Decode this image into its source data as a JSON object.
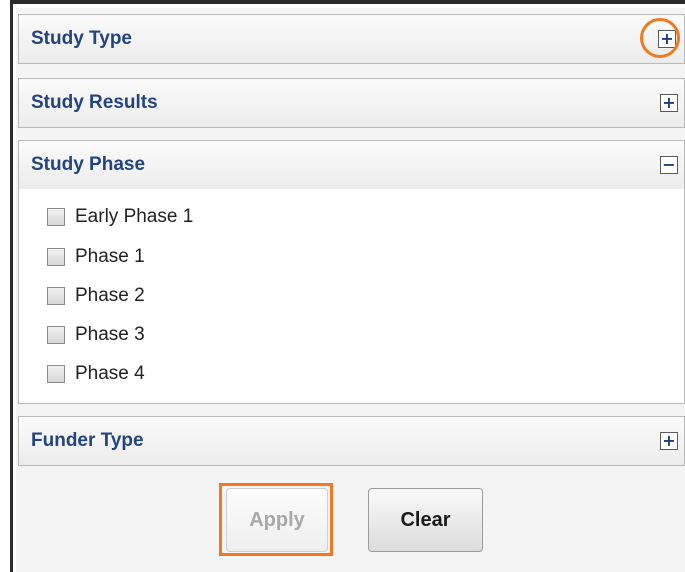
{
  "sections": {
    "study_type": {
      "title": "Study Type",
      "toggle": "+"
    },
    "study_results": {
      "title": "Study Results",
      "toggle": "+"
    },
    "study_phase": {
      "title": "Study Phase",
      "toggle": "−",
      "options": [
        "Early Phase 1",
        "Phase 1",
        "Phase 2",
        "Phase 3",
        "Phase 4"
      ]
    },
    "funder_type": {
      "title": "Funder Type",
      "toggle": "+"
    }
  },
  "buttons": {
    "apply": "Apply",
    "clear": "Clear"
  },
  "colors": {
    "header_text": "#23447f",
    "highlight": "#f07a22"
  }
}
